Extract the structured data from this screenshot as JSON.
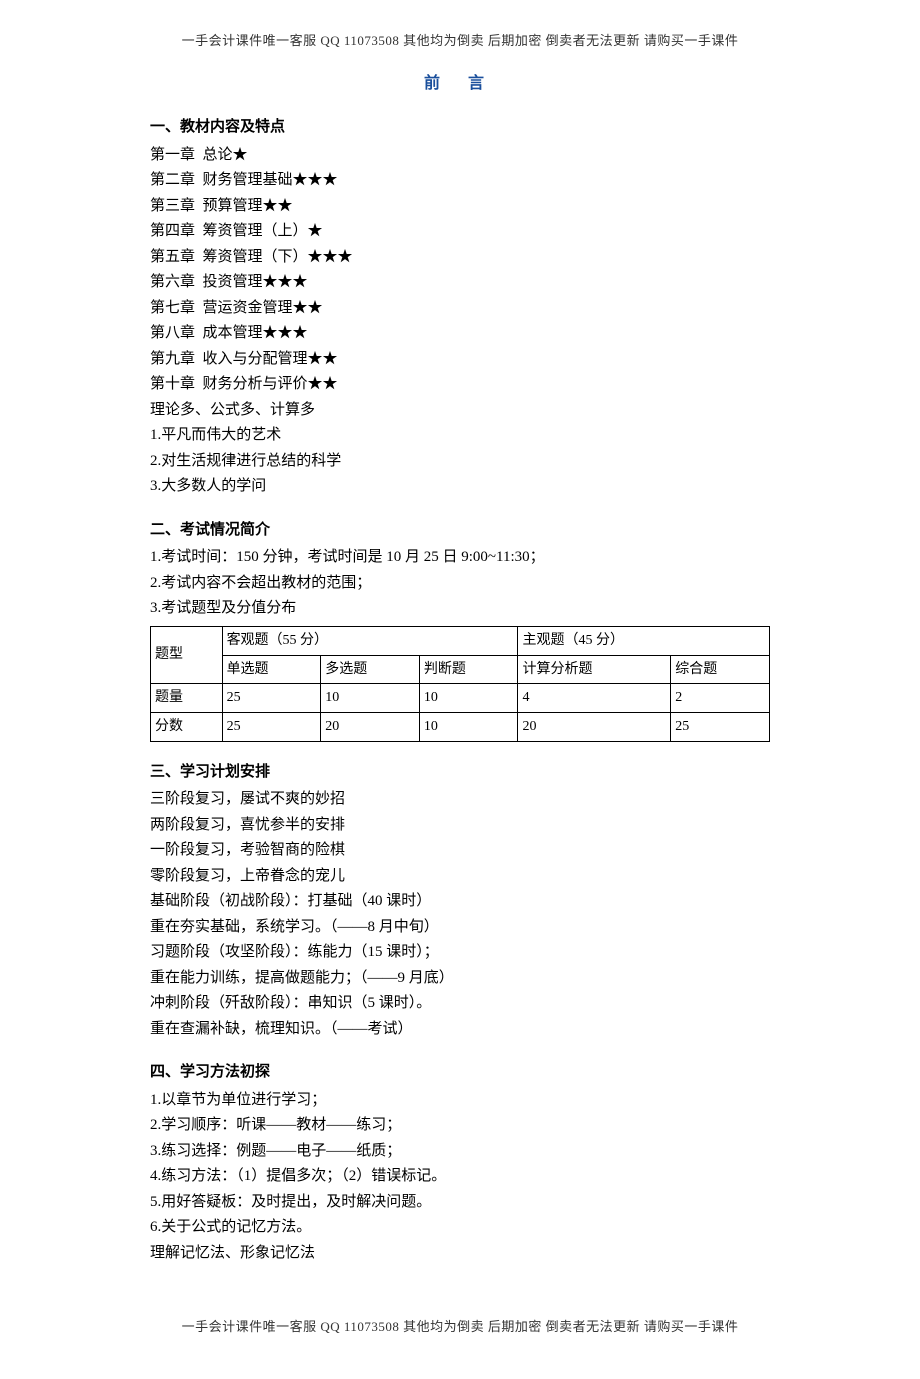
{
  "header_text": "一手会计课件唯一客服 QQ 11073508  其他均为倒卖  后期加密  倒卖者无法更新  请购买一手课件",
  "footer_text": "一手会计课件唯一客服 QQ 11073508  其他均为倒卖  后期加密  倒卖者无法更新  请购买一手课件",
  "title": "前 言",
  "s1": {
    "head": "一、教材内容及特点",
    "lines": [
      "第一章  总论★",
      "第二章  财务管理基础★★★",
      "第三章  预算管理★★",
      "第四章  筹资管理（上）★",
      "第五章  筹资管理（下）★★★",
      "第六章  投资管理★★★",
      "第七章  营运资金管理★★",
      "第八章  成本管理★★★",
      "第九章  收入与分配管理★★",
      "第十章  财务分析与评价★★",
      "理论多、公式多、计算多",
      "1.平凡而伟大的艺术",
      "2.对生活规律进行总结的科学",
      "3.大多数人的学问"
    ]
  },
  "s2": {
    "head": "二、考试情况简介",
    "lines": [
      "1.考试时间：150 分钟，考试时间是 10 月 25 日 9:00~11:30；",
      "2.考试内容不会超出教材的范围；",
      "3.考试题型及分值分布"
    ]
  },
  "table": {
    "r1c1": "题型",
    "r1c2": "客观题（55 分）",
    "r1c3": "主观题（45 分）",
    "r2": [
      "单选题",
      "多选题",
      "判断题",
      "计算分析题",
      "综合题"
    ],
    "r3_label": "题量",
    "r3": [
      "25",
      "10",
      "10",
      "4",
      "2"
    ],
    "r4_label": "分数",
    "r4": [
      "25",
      "20",
      "10",
      "20",
      "25"
    ]
  },
  "s3": {
    "head": "三、学习计划安排",
    "lines": [
      "三阶段复习，屡试不爽的妙招",
      "两阶段复习，喜忧参半的安排",
      "一阶段复习，考验智商的险棋",
      "零阶段复习，上帝眷念的宠儿",
      "基础阶段（初战阶段）：打基础（40 课时）",
      "重在夯实基础，系统学习。（——8 月中旬）",
      "习题阶段（攻坚阶段）：练能力（15 课时）；",
      "重在能力训练，提高做题能力；（——9 月底）",
      "冲刺阶段（歼敌阶段）：串知识（5 课时）。",
      "重在查漏补缺，梳理知识。（——考试）"
    ]
  },
  "s4": {
    "head": "四、学习方法初探",
    "lines": [
      "1.以章节为单位进行学习；",
      "2.学习顺序：听课——教材——练习；",
      "3.练习选择：例题——电子——纸质；",
      "4.练习方法：（1）提倡多次；（2）错误标记。",
      "5.用好答疑板：及时提出，及时解决问题。",
      "6.关于公式的记忆方法。",
      "理解记忆法、形象记忆法"
    ]
  }
}
